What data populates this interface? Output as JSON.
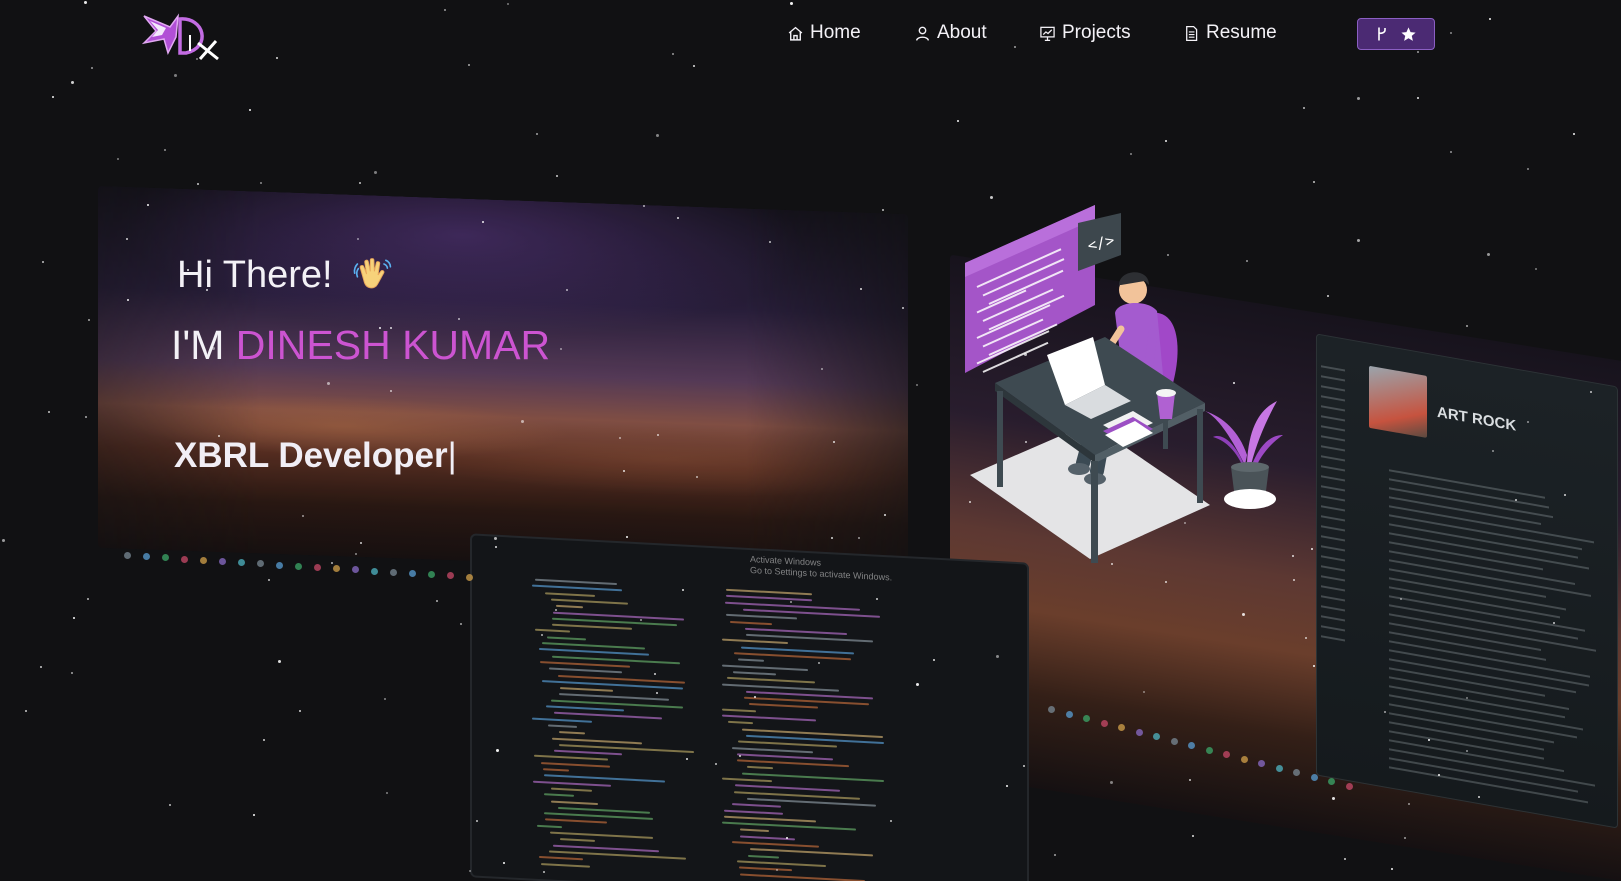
{
  "nav": {
    "logo": "DK",
    "items": [
      {
        "label": "Home",
        "icon": "home-icon"
      },
      {
        "label": "About",
        "icon": "user-icon"
      },
      {
        "label": "Projects",
        "icon": "presentation-icon"
      },
      {
        "label": "Resume",
        "icon": "document-icon"
      }
    ],
    "github_button": {
      "icons": [
        "fork-icon",
        "star-icon"
      ]
    }
  },
  "hero": {
    "greeting": "Hi There!",
    "greeting_emoji": "waving-hand-icon",
    "intro_prefix": "I'M",
    "name": "DINESH KUMAR",
    "role": "XBRL Developer",
    "cursor": "|"
  },
  "background": {
    "activate_title": "Activate Windows",
    "activate_subtitle": "Go to Settings to activate Windows.",
    "app_title": "ART ROCK"
  },
  "colors": {
    "background": "#111113",
    "accent": "#cc54d1",
    "button_bg": "#4b2a73",
    "button_border": "#8b5fc3"
  }
}
